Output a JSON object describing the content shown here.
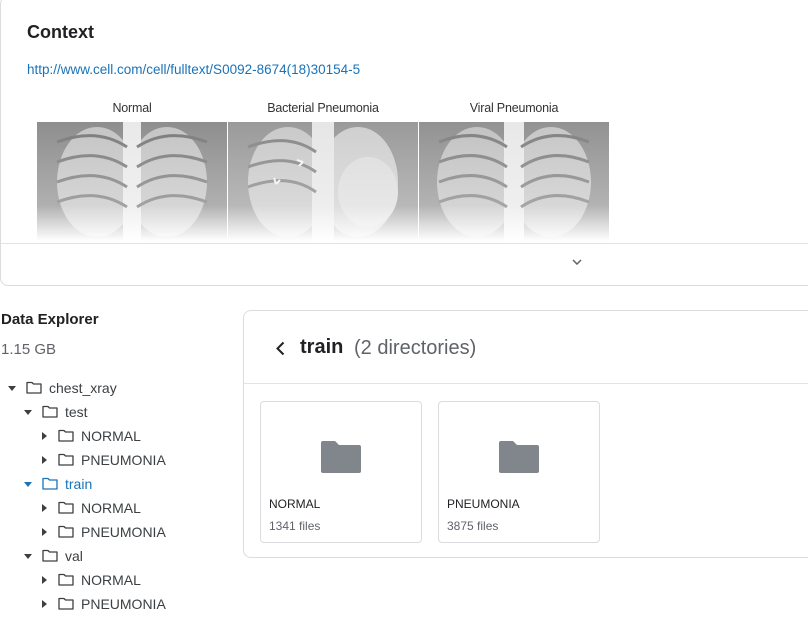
{
  "context": {
    "title": "Context",
    "link": "http://www.cell.com/cell/fulltext/S0092-8674(18)30154-5",
    "image_captions": [
      "Normal",
      "Bacterial Pneumonia",
      "Viral Pneumonia"
    ]
  },
  "data_explorer": {
    "title": "Data Explorer",
    "size": "1.15 GB",
    "tree": [
      {
        "label": "chest_xray",
        "level": 0,
        "expanded": true,
        "active": false
      },
      {
        "label": "test",
        "level": 1,
        "expanded": true,
        "active": false
      },
      {
        "label": "NORMAL",
        "level": 2,
        "expanded": false,
        "active": false
      },
      {
        "label": "PNEUMONIA",
        "level": 2,
        "expanded": false,
        "active": false
      },
      {
        "label": "train",
        "level": 1,
        "expanded": true,
        "active": true
      },
      {
        "label": "NORMAL",
        "level": 2,
        "expanded": false,
        "active": false
      },
      {
        "label": "PNEUMONIA",
        "level": 2,
        "expanded": false,
        "active": false
      },
      {
        "label": "val",
        "level": 1,
        "expanded": true,
        "active": false
      },
      {
        "label": "NORMAL",
        "level": 2,
        "expanded": false,
        "active": false
      },
      {
        "label": "PNEUMONIA",
        "level": 2,
        "expanded": false,
        "active": false
      }
    ]
  },
  "directory_panel": {
    "name": "train",
    "count_label": "(2 directories)",
    "cards": [
      {
        "name": "NORMAL",
        "files": "1341 files"
      },
      {
        "name": "PNEUMONIA",
        "files": "3875 files"
      }
    ]
  },
  "colors": {
    "accent": "#1a73b8",
    "text": "#202124",
    "muted": "#5f6368",
    "folder_icon": "#80868b",
    "border": "#dadce0"
  },
  "icons": {
    "expand": "chevron-down-icon",
    "back": "chevron-left-icon",
    "folder": "folder-icon",
    "tree_expanded": "caret-down-icon",
    "tree_collapsed": "caret-right-icon"
  }
}
